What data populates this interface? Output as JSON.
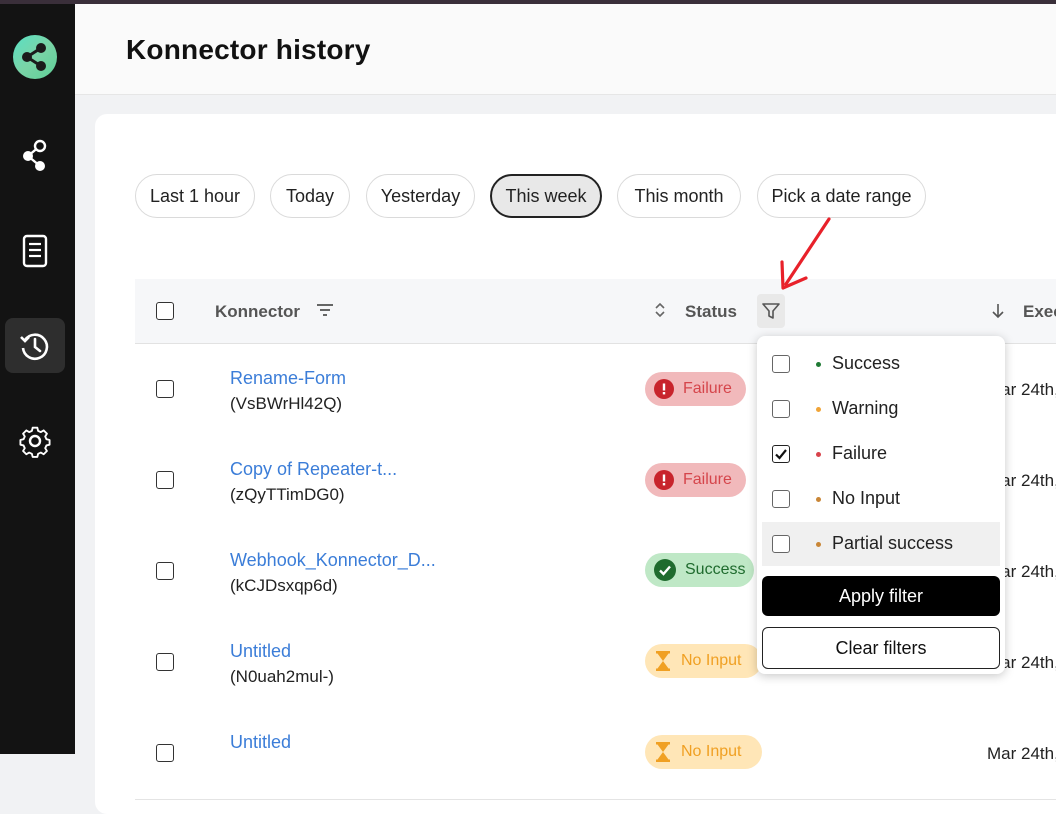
{
  "header": {
    "title": "Konnector history"
  },
  "sidebar": {
    "items": [
      {
        "icon": "share-icon",
        "active": false
      },
      {
        "icon": "document-icon",
        "active": false
      },
      {
        "icon": "history-icon",
        "active": true
      },
      {
        "icon": "gear-icon",
        "active": false
      }
    ]
  },
  "date_filters": [
    "Last 1 hour",
    "Today",
    "Yesterday",
    "This week",
    "This month",
    "Pick a date range"
  ],
  "date_filter_selected": "This week",
  "table": {
    "columns": {
      "konnector": "Konnector",
      "status": "Status",
      "executed": "Exec"
    },
    "rows": [
      {
        "name": "Rename-Form",
        "id": "(VsBWrHl42Q)",
        "status": "Failure",
        "date": "Mar 24th,"
      },
      {
        "name": "Copy of Repeater-t...",
        "id": "(zQyTTimDG0)",
        "status": "Failure",
        "date": "Mar 24th,"
      },
      {
        "name": "Webhook_Konnector_D...",
        "id": "(kCJDsxqp6d)",
        "status": "Success",
        "date": "Mar 24th,"
      },
      {
        "name": "Untitled",
        "id": "(N0uah2mul-)",
        "status": "No Input",
        "date": "Mar 24th,"
      },
      {
        "name": "Untitled",
        "id": "",
        "status": "No Input",
        "date": "Mar 24th,"
      }
    ]
  },
  "status_filter": {
    "options": [
      {
        "label": "Success",
        "checked": false,
        "dot_color": "#1f7a34"
      },
      {
        "label": "Warning",
        "checked": false,
        "dot_color": "#f0a437"
      },
      {
        "label": "Failure",
        "checked": true,
        "dot_color": "#d8434b"
      },
      {
        "label": "No Input",
        "checked": false,
        "dot_color": "#c98636"
      },
      {
        "label": "Partial success",
        "checked": false,
        "dot_color": "#c98636"
      }
    ],
    "apply_label": "Apply filter",
    "clear_label": "Clear filters"
  },
  "colors": {
    "link": "#3b7dd8",
    "annotation_arrow": "#e8212a",
    "sidebar_bg": "#131313"
  }
}
